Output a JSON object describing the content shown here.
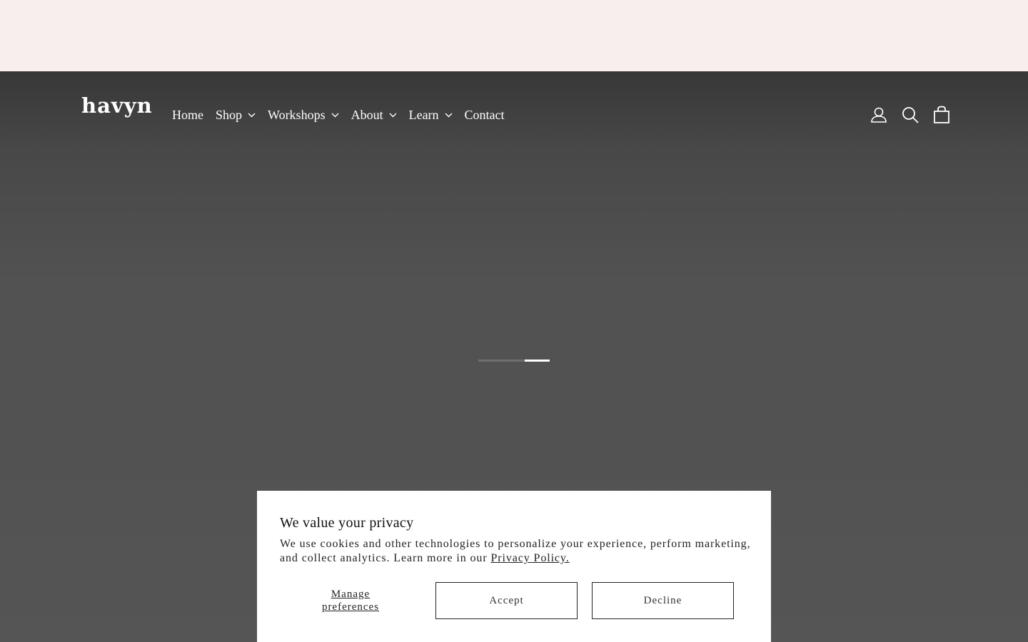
{
  "logo": {
    "text": "havyn"
  },
  "nav": {
    "items": [
      {
        "label": "Home",
        "has_dropdown": false
      },
      {
        "label": "Shop",
        "has_dropdown": true
      },
      {
        "label": "Workshops",
        "has_dropdown": true
      },
      {
        "label": "About",
        "has_dropdown": true
      },
      {
        "label": "Learn",
        "has_dropdown": true
      },
      {
        "label": "Contact",
        "has_dropdown": false
      }
    ]
  },
  "header_icons": [
    "account-icon",
    "search-icon",
    "cart-icon"
  ],
  "slider": {
    "slides": 2,
    "active_index": 1
  },
  "cookie_banner": {
    "title": "We value your privacy",
    "text": "We use cookies and other technologies to personalize your experience, perform marketing, and collect analytics. Learn more in our ",
    "link": "Privacy Policy.",
    "manage_line1": "Manage",
    "manage_line2": "preferences",
    "accept": "Accept",
    "decline": "Decline"
  },
  "colors": {
    "announcement_bar": "#f8eeed",
    "hero_background": "#525252",
    "banner_background": "#ffffff",
    "text_light": "#ffffff",
    "text_dark": "#222222"
  }
}
